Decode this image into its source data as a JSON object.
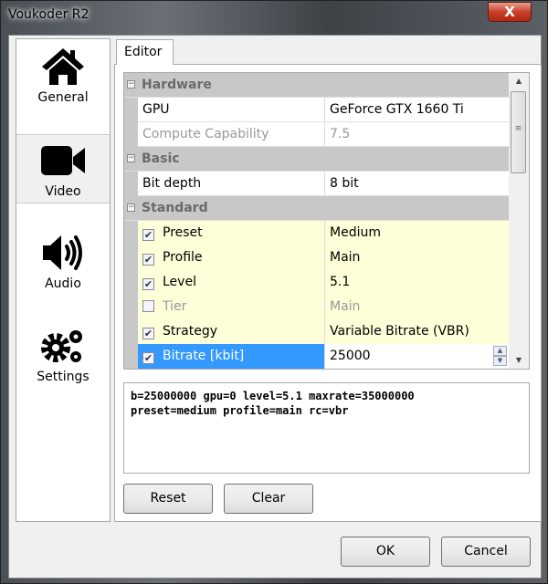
{
  "window": {
    "title": "Voukoder R2",
    "close": "X"
  },
  "sidebar": {
    "items": [
      {
        "label": "General",
        "icon": "home-icon"
      },
      {
        "label": "Video",
        "icon": "video-camera-icon",
        "selected": true
      },
      {
        "label": "Audio",
        "icon": "speaker-icon"
      },
      {
        "label": "Settings",
        "icon": "gears-icon"
      }
    ]
  },
  "tab": {
    "label": "Editor"
  },
  "grid": {
    "hardware": "Hardware",
    "gpu": {
      "name": "GPU",
      "value": "GeForce GTX 1660 Ti"
    },
    "compute": {
      "name": "Compute Capability",
      "value": "7.5"
    },
    "basic": "Basic",
    "bitdepth": {
      "name": "Bit depth",
      "value": "8 bit"
    },
    "standard": "Standard",
    "preset": {
      "name": "Preset",
      "value": "Medium",
      "checked": true
    },
    "profile": {
      "name": "Profile",
      "value": "Main",
      "checked": true
    },
    "level": {
      "name": "Level",
      "value": "5.1",
      "checked": true
    },
    "tier": {
      "name": "Tier",
      "value": "Main",
      "checked": false
    },
    "strategy": {
      "name": "Strategy",
      "value": "Variable Bitrate (VBR)",
      "checked": true
    },
    "bitrate": {
      "name": "Bitrate [kbit]",
      "value": "25000",
      "checked": true
    }
  },
  "output": "b=25000000 gpu=0 level=5.1 maxrate=35000000\npreset=medium profile=main rc=vbr",
  "buttons": {
    "reset": "Reset",
    "clear": "Clear",
    "ok": "OK",
    "cancel": "Cancel"
  },
  "colors": {
    "selection": "#3399ff",
    "modified_row": "#fefed8",
    "category": "#c8c8c8"
  }
}
